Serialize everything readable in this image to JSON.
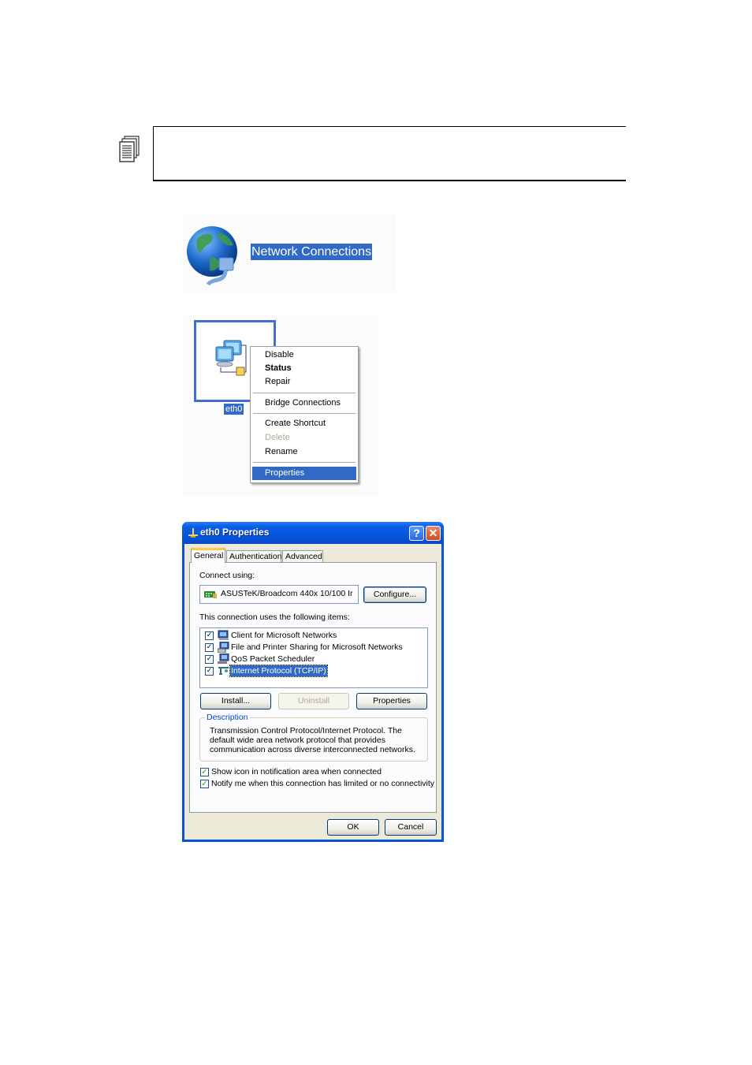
{
  "note": {
    "icon": "notes-pages-icon",
    "text": ""
  },
  "network_connections": {
    "icon": "network-globe-icon",
    "label": "Network Connections"
  },
  "context_section": {
    "connection_name": "eth0",
    "connection_icon": "network-computers-icon",
    "menu_items": [
      {
        "label": "Disable",
        "style": "normal"
      },
      {
        "label": "Status",
        "style": "bold"
      },
      {
        "label": "Repair",
        "style": "normal"
      },
      {
        "label": "Bridge Connections",
        "style": "normal"
      },
      {
        "label": "Create Shortcut",
        "style": "normal"
      },
      {
        "label": "Delete",
        "style": "disabled"
      },
      {
        "label": "Rename",
        "style": "normal"
      },
      {
        "label": "Properties",
        "style": "selected"
      }
    ]
  },
  "dialog": {
    "title": "eth0 Properties",
    "title_icon": "network-plug-icon",
    "help_button": "?",
    "close_button": "✕",
    "tabs": [
      {
        "label": "General",
        "active": true
      },
      {
        "label": "Authentication",
        "active": false
      },
      {
        "label": "Advanced",
        "active": false
      }
    ],
    "connect_using_label": "Connect using:",
    "adapter_name": "ASUSTeK/Broadcom 440x 10/100 Ir",
    "adapter_icon": "network-card-icon",
    "configure_button": "Configure...",
    "items_label": "This connection uses the following items:",
    "items": [
      {
        "label": "Client for Microsoft Networks",
        "checked": true,
        "icon": "client-network-icon",
        "selected": false
      },
      {
        "label": "File and Printer Sharing for Microsoft Networks",
        "checked": true,
        "icon": "file-printer-sharing-icon",
        "selected": false
      },
      {
        "label": "QoS Packet Scheduler",
        "checked": true,
        "icon": "qos-scheduler-icon",
        "selected": false
      },
      {
        "label": "Internet Protocol (TCP/IP)",
        "checked": true,
        "icon": "tcpip-protocol-icon",
        "selected": true
      }
    ],
    "install_button": "Install...",
    "uninstall_button": "Uninstall",
    "properties_button": "Properties",
    "description_legend": "Description",
    "description_text": "Transmission Control Protocol/Internet Protocol. The default wide area network protocol that provides communication across diverse interconnected networks.",
    "show_icon_checkbox": {
      "label": "Show icon in notification area when connected",
      "checked": true
    },
    "notify_checkbox": {
      "label": "Notify me when this connection has limited or no connectivity",
      "checked": true
    },
    "ok_button": "OK",
    "cancel_button": "Cancel"
  }
}
